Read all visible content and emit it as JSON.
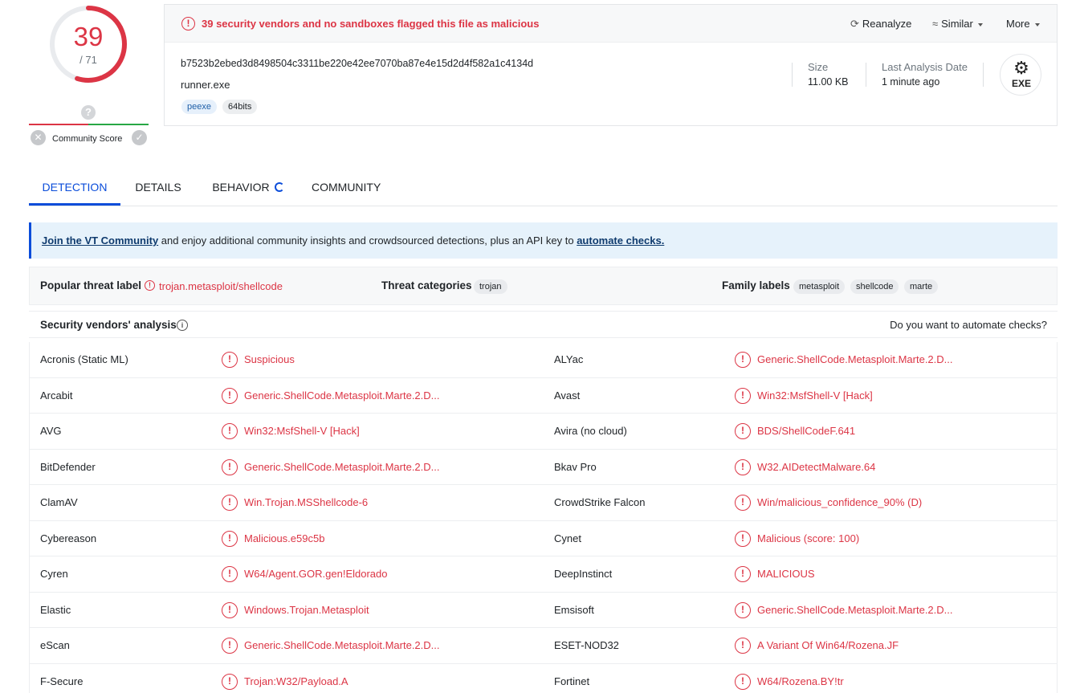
{
  "score": {
    "detections": "39",
    "total": "/ 71"
  },
  "community": {
    "label": "Community Score",
    "question": "?",
    "down": "✕",
    "up": "✓"
  },
  "header": {
    "alert": "39 security vendors and no sandboxes flagged this file as malicious",
    "actions": {
      "reanalyze": "Reanalyze",
      "similar": "Similar",
      "more": "More"
    },
    "hash": "b7523b2ebed3d8498504c3311be220e42ee7070ba87e4e15d2d4f582a1c4134d",
    "filename": "runner.exe",
    "tags": [
      "peexe",
      "64bits"
    ],
    "size_label": "Size",
    "size_value": "11.00 KB",
    "date_label": "Last Analysis Date",
    "date_value": "1 minute ago",
    "filetype": "EXE"
  },
  "tabs": [
    "DETECTION",
    "DETAILS",
    "BEHAVIOR",
    "COMMUNITY"
  ],
  "banner": {
    "link1": "Join the VT Community",
    "middle": " and enjoy additional community insights and crowdsourced detections, plus an API key to ",
    "link2": "automate checks."
  },
  "threat": {
    "popular_label": "Popular threat label",
    "popular_value": "trojan.metasploit/shellcode",
    "categories_label": "Threat categories",
    "categories": [
      "trojan"
    ],
    "family_label": "Family labels",
    "families": [
      "metasploit",
      "shellcode",
      "marte"
    ]
  },
  "vendors_header": {
    "title": "Security vendors' analysis",
    "right": "Do you want to automate checks?"
  },
  "vendors": [
    [
      {
        "name": "Acronis (Static ML)",
        "result": "Suspicious"
      },
      {
        "name": "ALYac",
        "result": "Generic.ShellCode.Metasploit.Marte.2.D..."
      }
    ],
    [
      {
        "name": "Arcabit",
        "result": "Generic.ShellCode.Metasploit.Marte.2.D..."
      },
      {
        "name": "Avast",
        "result": "Win32:MsfShell-V [Hack]"
      }
    ],
    [
      {
        "name": "AVG",
        "result": "Win32:MsfShell-V [Hack]"
      },
      {
        "name": "Avira (no cloud)",
        "result": "BDS/ShellCodeF.641"
      }
    ],
    [
      {
        "name": "BitDefender",
        "result": "Generic.ShellCode.Metasploit.Marte.2.D..."
      },
      {
        "name": "Bkav Pro",
        "result": "W32.AIDetectMalware.64"
      }
    ],
    [
      {
        "name": "ClamAV",
        "result": "Win.Trojan.MSShellcode-6"
      },
      {
        "name": "CrowdStrike Falcon",
        "result": "Win/malicious_confidence_90% (D)"
      }
    ],
    [
      {
        "name": "Cybereason",
        "result": "Malicious.e59c5b"
      },
      {
        "name": "Cynet",
        "result": "Malicious (score: 100)"
      }
    ],
    [
      {
        "name": "Cyren",
        "result": "W64/Agent.GOR.gen!Eldorado"
      },
      {
        "name": "DeepInstinct",
        "result": "MALICIOUS"
      }
    ],
    [
      {
        "name": "Elastic",
        "result": "Windows.Trojan.Metasploit"
      },
      {
        "name": "Emsisoft",
        "result": "Generic.ShellCode.Metasploit.Marte.2.D..."
      }
    ],
    [
      {
        "name": "eScan",
        "result": "Generic.ShellCode.Metasploit.Marte.2.D..."
      },
      {
        "name": "ESET-NOD32",
        "result": "A Variant Of Win64/Rozena.JF"
      }
    ],
    [
      {
        "name": "F-Secure",
        "result": "Trojan:W32/Payload.A"
      },
      {
        "name": "Fortinet",
        "result": "W64/Rozena.BY!tr"
      }
    ]
  ],
  "colors": {
    "malicious": "#dc3545",
    "accent": "#0b4dda",
    "positive": "#28a745"
  }
}
